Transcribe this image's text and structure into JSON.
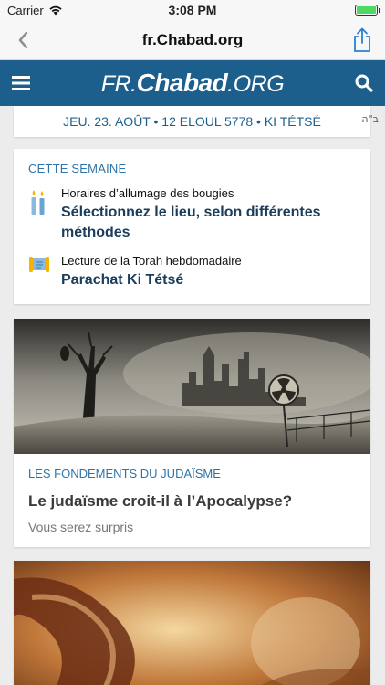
{
  "status_bar": {
    "carrier": "Carrier",
    "time": "3:08 PM"
  },
  "browser": {
    "url_title": "fr.Chabad.org"
  },
  "site": {
    "logo_prefix": "FR.",
    "logo_brand": "Chabad",
    "logo_suffix": ".ORG",
    "brand_color": "#1d5f8c"
  },
  "date_bar": {
    "text": "JEU. 23. AOÛT • 12 ELOUL 5778 • KI TÉTSÉ",
    "bsd": "ב\"ה"
  },
  "this_week": {
    "heading": "CETTE SEMAINE",
    "items": [
      {
        "icon": "candles-icon",
        "label": "Horaires d’allumage des bougies",
        "value": "Sélectionnez le lieu, selon différentes méthodes"
      },
      {
        "icon": "torah-scroll-icon",
        "label": "Lecture de la Torah hebdomadaire",
        "value": "Parachat Ki Tétsé"
      }
    ]
  },
  "articles": [
    {
      "category": "LES FONDEMENTS DU JUDAÏSME",
      "title": "Le judaïsme croit-il à l’Apocalypse?",
      "subtitle": "Vous serez surpris",
      "image": "apocalypse-ruins-image"
    },
    {
      "image": "shofar-image"
    }
  ]
}
